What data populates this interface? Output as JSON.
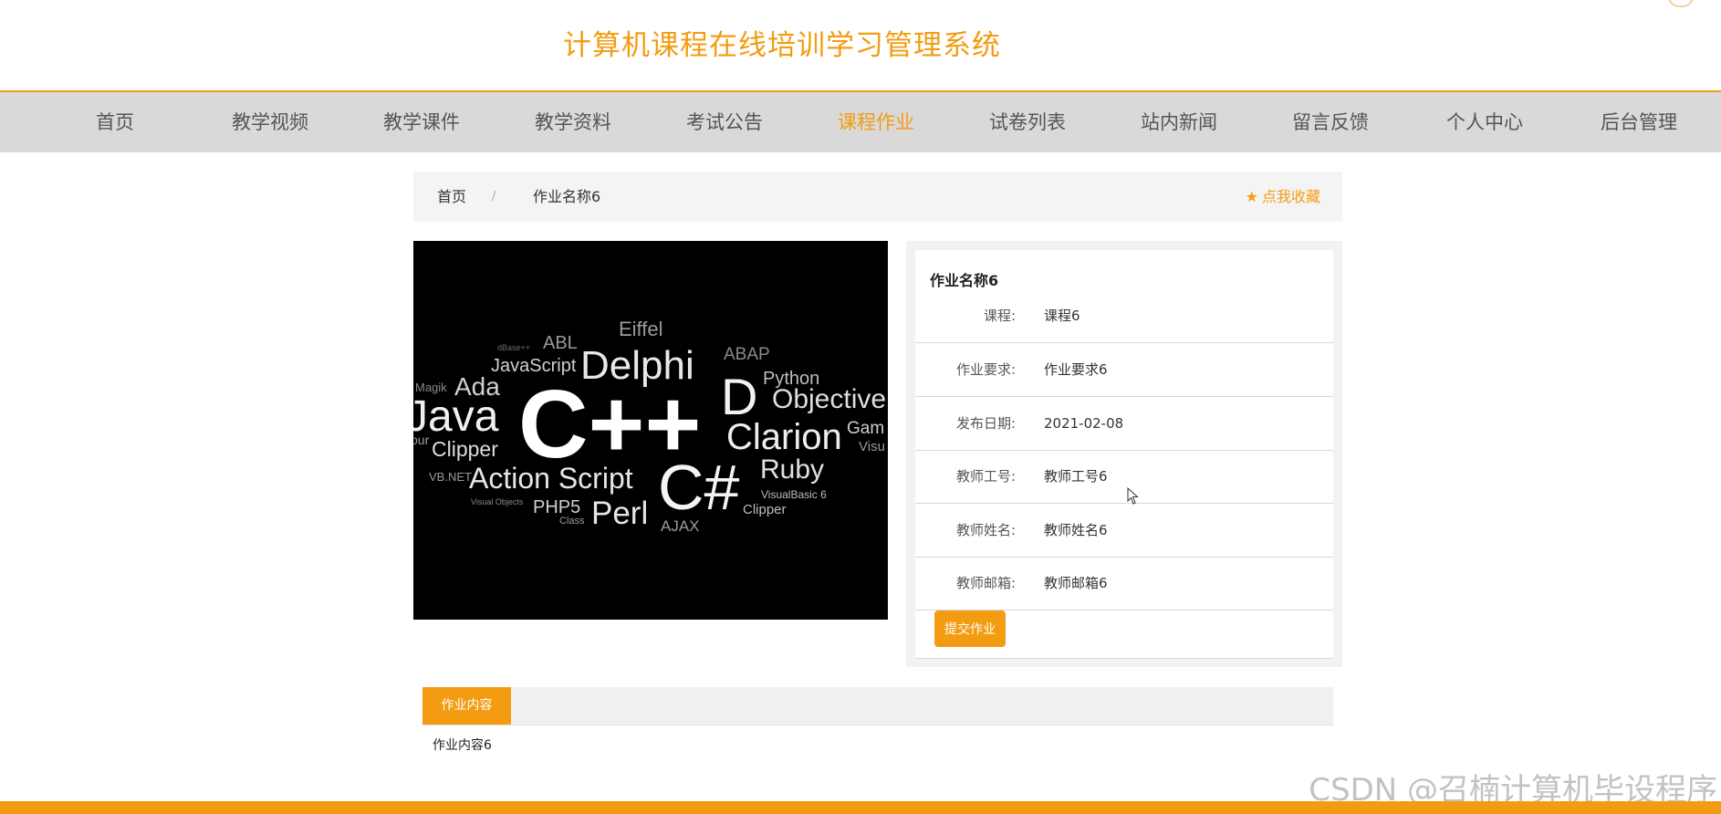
{
  "site": {
    "title": "计算机课程在线培训学习管理系统"
  },
  "nav": {
    "items": [
      {
        "label": "首页",
        "active": false
      },
      {
        "label": "教学视频",
        "active": false
      },
      {
        "label": "教学课件",
        "active": false
      },
      {
        "label": "教学资料",
        "active": false
      },
      {
        "label": "考试公告",
        "active": false
      },
      {
        "label": "课程作业",
        "active": true
      },
      {
        "label": "试卷列表",
        "active": false
      },
      {
        "label": "站内新闻",
        "active": false
      },
      {
        "label": "留言反馈",
        "active": false
      },
      {
        "label": "个人中心",
        "active": false
      },
      {
        "label": "后台管理",
        "active": false
      }
    ]
  },
  "breadcrumb": {
    "home": "首页",
    "separator": "/",
    "current": "作业名称6",
    "favorite": "点我收藏"
  },
  "cover_words": [
    "Eiffel",
    "ABL",
    "ABAP",
    "Delphi",
    "JavaScript",
    "Python",
    "Magik",
    "Ada",
    "Java",
    "C++",
    "D",
    "Objective",
    "Clarion",
    "Gam",
    "Visu",
    "our",
    "Clipper",
    "VB.NET",
    "Action Script",
    "C#",
    "Ruby",
    "VisualBasic 6",
    "Visual Objects",
    "PHP5",
    "Class",
    "Perl",
    "AJAX",
    "Clipper",
    "dBase++"
  ],
  "detail": {
    "title": "作业名称6",
    "rows": [
      {
        "label": "课程:",
        "value": "课程6"
      },
      {
        "label": "作业要求:",
        "value": "作业要求6"
      },
      {
        "label": "发布日期:",
        "value": "2021-02-08"
      },
      {
        "label": "教师工号:",
        "value": "教师工号6"
      },
      {
        "label": "教师姓名:",
        "value": "教师姓名6"
      },
      {
        "label": "教师邮箱:",
        "value": "教师邮箱6"
      }
    ],
    "submit_label": "提交作业"
  },
  "content": {
    "tab_label": "作业内容",
    "body": "作业内容6"
  },
  "watermark": "CSDN @召楠计算机毕设程序",
  "colors": {
    "accent": "#f39c12",
    "nav_bg": "#d9d9d9",
    "panel_bg": "#f4f4f4"
  }
}
